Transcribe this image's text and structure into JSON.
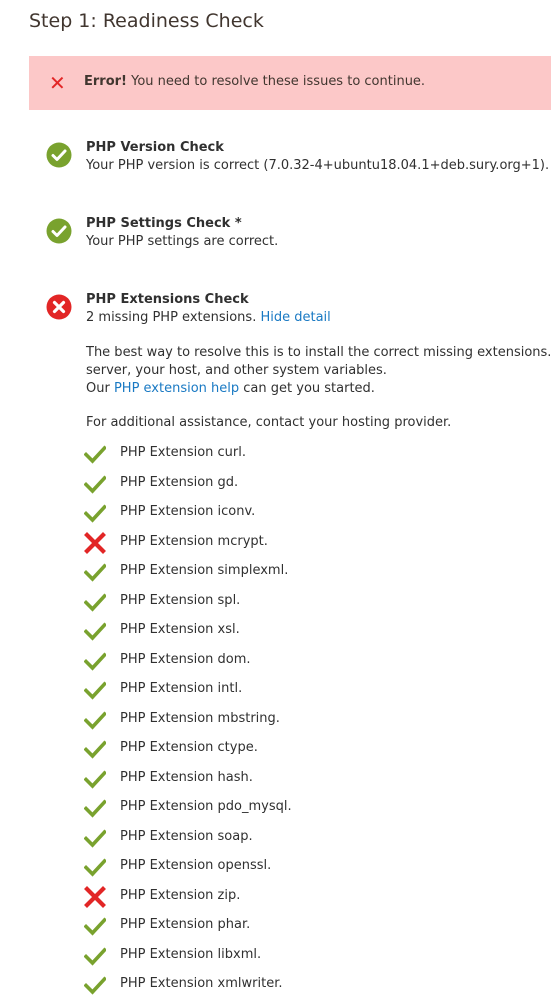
{
  "header": {
    "title": "Step 1: Readiness Check"
  },
  "error_banner": {
    "strong": "Error!",
    "message": " You need to resolve these issues to continue."
  },
  "checks": {
    "php_version": {
      "title": "PHP Version Check",
      "description": "Your PHP version is correct (7.0.32-4+ubuntu18.04.1+deb.sury.org+1).",
      "status": "ok"
    },
    "php_settings": {
      "title": "PHP Settings Check *",
      "description": "Your PHP settings are correct.",
      "status": "ok"
    },
    "php_extensions": {
      "title": "PHP Extensions Check",
      "description": "2 missing PHP extensions.",
      "hide_detail_link": "Hide detail",
      "status": "error",
      "detail_line1": "The best way to resolve this is to install the correct missing extensions. T",
      "detail_line2": "server, your host, and other system variables.",
      "detail_line3_prefix": "Our ",
      "detail_line3_link": "PHP extension help",
      "detail_line3_suffix": " can get you started.",
      "assistance": "For additional assistance, contact your hosting provider."
    }
  },
  "extensions": [
    {
      "label": "PHP Extension curl.",
      "status": "ok"
    },
    {
      "label": "PHP Extension gd.",
      "status": "ok"
    },
    {
      "label": "PHP Extension iconv.",
      "status": "ok"
    },
    {
      "label": "PHP Extension mcrypt.",
      "status": "missing"
    },
    {
      "label": "PHP Extension simplexml.",
      "status": "ok"
    },
    {
      "label": "PHP Extension spl.",
      "status": "ok"
    },
    {
      "label": "PHP Extension xsl.",
      "status": "ok"
    },
    {
      "label": "PHP Extension dom.",
      "status": "ok"
    },
    {
      "label": "PHP Extension intl.",
      "status": "ok"
    },
    {
      "label": "PHP Extension mbstring.",
      "status": "ok"
    },
    {
      "label": "PHP Extension ctype.",
      "status": "ok"
    },
    {
      "label": "PHP Extension hash.",
      "status": "ok"
    },
    {
      "label": "PHP Extension pdo_mysql.",
      "status": "ok"
    },
    {
      "label": "PHP Extension soap.",
      "status": "ok"
    },
    {
      "label": "PHP Extension openssl.",
      "status": "ok"
    },
    {
      "label": "PHP Extension zip.",
      "status": "missing"
    },
    {
      "label": "PHP Extension phar.",
      "status": "ok"
    },
    {
      "label": "PHP Extension libxml.",
      "status": "ok"
    },
    {
      "label": "PHP Extension xmlwriter.",
      "status": "ok"
    }
  ],
  "colors": {
    "ok_green": "#79a22e",
    "error_red": "#e22626",
    "banner_bg": "#fcc8c8",
    "link_blue": "#1979c3"
  }
}
